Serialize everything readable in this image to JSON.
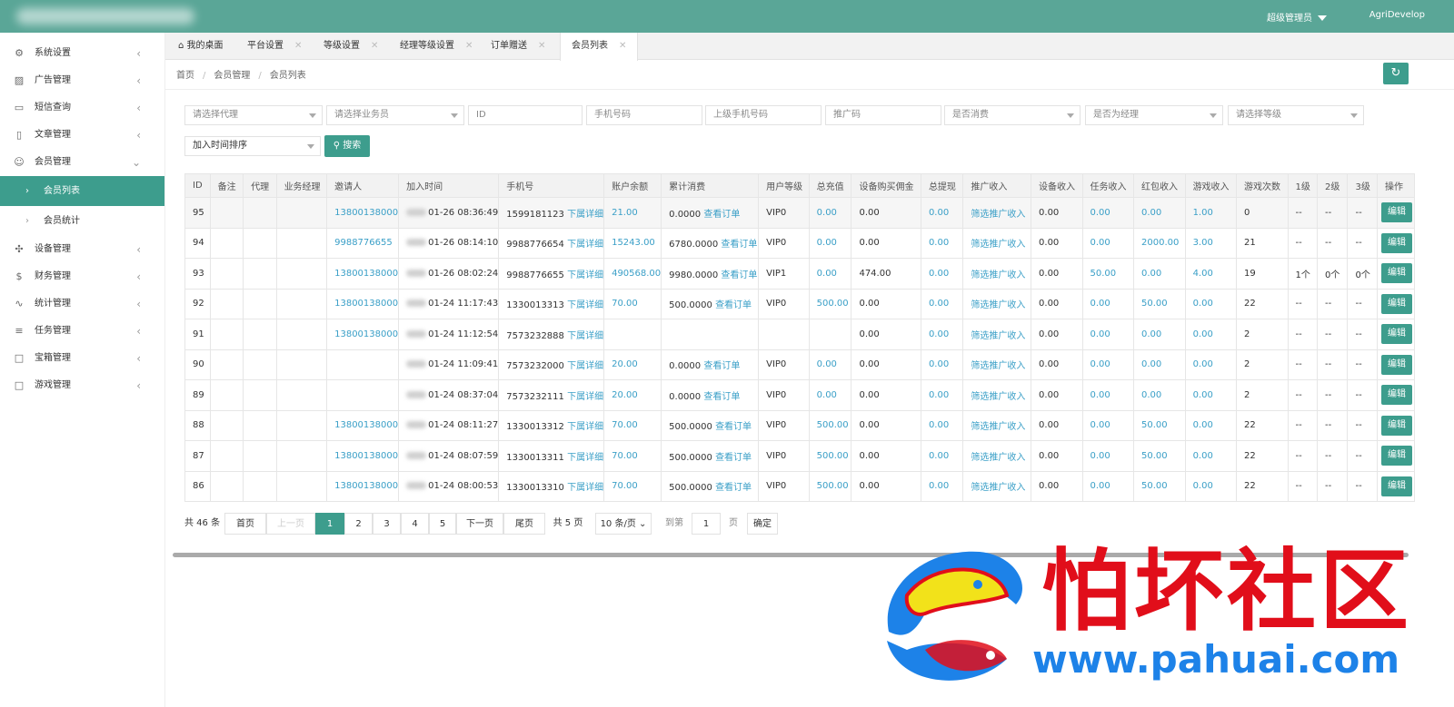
{
  "header": {
    "user": "超级管理员",
    "project": "AgriDevelop"
  },
  "sidebar": {
    "items": [
      {
        "label": "系统设置",
        "icon": "gear-icon"
      },
      {
        "label": "广告管理",
        "icon": "image-icon"
      },
      {
        "label": "短信查询",
        "icon": "message-icon"
      },
      {
        "label": "文章管理",
        "icon": "book-icon"
      },
      {
        "label": "会员管理",
        "icon": "user-icon"
      },
      {
        "label": "设备管理",
        "icon": "device-icon"
      },
      {
        "label": "财务管理",
        "icon": "dollar-icon"
      },
      {
        "label": "统计管理",
        "icon": "pulse-icon"
      },
      {
        "label": "任务管理",
        "icon": "sliders-icon"
      },
      {
        "label": "宝箱管理",
        "icon": "gift-icon"
      },
      {
        "label": "游戏管理",
        "icon": "gamepad-icon"
      }
    ],
    "sub": [
      {
        "label": "会员列表"
      },
      {
        "label": "会员统计"
      }
    ]
  },
  "tabs": [
    {
      "label": "我的桌面"
    },
    {
      "label": "平台设置"
    },
    {
      "label": "等级设置"
    },
    {
      "label": "经理等级设置"
    },
    {
      "label": "订单赠送"
    },
    {
      "label": "会员列表"
    }
  ],
  "breadcrumb": [
    "首页",
    "会员管理",
    "会员列表"
  ],
  "filters": {
    "agent": "请选择代理",
    "salesman": "请选择业务员",
    "id": "ID",
    "phone": "手机号码",
    "parent_phone": "上级手机号码",
    "promo": "推广码",
    "consumed": "是否消费",
    "manager": "是否为经理",
    "level": "请选择等级",
    "sort": "加入时间排序",
    "search": "搜索"
  },
  "table": {
    "headers": [
      "ID",
      "备注",
      "代理",
      "业务经理",
      "邀请人",
      "加入时间",
      "手机号",
      "账户余额",
      "累计消费",
      "用户等级",
      "总充值",
      "设备购买佣金",
      "总提现",
      "推广收入",
      "设备收入",
      "任务收入",
      "红包收入",
      "游戏收入",
      "游戏次数",
      "1级",
      "2级",
      "3级",
      "操作"
    ],
    "detail_link": "下属详细",
    "order_link": "查看订单",
    "promo_link": "筛选推广收入",
    "edit_label": "编辑",
    "rows": [
      {
        "id": "95",
        "inviter": "13800138000",
        "time": "01-26 08:36:49",
        "phone": "1599181123",
        "balance": "21.00",
        "spent": "0.0000",
        "level": "VIP0",
        "recharge": "0.00",
        "commission": "0.00",
        "withdraw": "0.00",
        "device": "0.00",
        "task": "0.00",
        "redpack": "0.00",
        "game": "1.00",
        "count": "0",
        "l1": "--",
        "l2": "--",
        "l3": "--"
      },
      {
        "id": "94",
        "inviter": "9988776655",
        "time": "01-26 08:14:10",
        "phone": "9988776654",
        "balance": "15243.00",
        "spent": "6780.0000",
        "level": "VIP0",
        "recharge": "0.00",
        "commission": "0.00",
        "withdraw": "0.00",
        "device": "0.00",
        "task": "0.00",
        "redpack": "2000.00",
        "game": "3.00",
        "count": "21",
        "l1": "--",
        "l2": "--",
        "l3": "--"
      },
      {
        "id": "93",
        "inviter": "13800138000",
        "time": "01-26 08:02:24",
        "phone": "9988776655",
        "balance": "490568.00",
        "spent": "9980.0000",
        "level": "VIP1",
        "recharge": "0.00",
        "commission": "474.00",
        "withdraw": "0.00",
        "device": "0.00",
        "task": "50.00",
        "redpack": "0.00",
        "game": "4.00",
        "count": "19",
        "l1": "1个",
        "l2": "0个",
        "l3": "0个"
      },
      {
        "id": "92",
        "inviter": "13800138000",
        "time": "01-24 11:17:43",
        "phone": "1330013313",
        "balance": "70.00",
        "spent": "500.0000",
        "level": "VIP0",
        "recharge": "500.00",
        "commission": "0.00",
        "withdraw": "0.00",
        "device": "0.00",
        "task": "0.00",
        "redpack": "50.00",
        "game": "0.00",
        "count": "22",
        "l1": "--",
        "l2": "--",
        "l3": "--"
      },
      {
        "id": "91",
        "inviter": "13800138000",
        "time": "01-24 11:12:54",
        "phone": "7573232888",
        "balance": "",
        "spent": "",
        "level": "",
        "recharge": "",
        "commission": "0.00",
        "withdraw": "0.00",
        "device": "0.00",
        "task": "0.00",
        "redpack": "0.00",
        "game": "0.00",
        "count": "2",
        "l1": "--",
        "l2": "--",
        "l3": "--"
      },
      {
        "id": "90",
        "inviter": "",
        "time": "01-24 11:09:41",
        "phone": "7573232000",
        "balance": "20.00",
        "spent": "0.0000",
        "level": "VIP0",
        "recharge": "0.00",
        "commission": "0.00",
        "withdraw": "0.00",
        "device": "0.00",
        "task": "0.00",
        "redpack": "0.00",
        "game": "0.00",
        "count": "2",
        "l1": "--",
        "l2": "--",
        "l3": "--"
      },
      {
        "id": "89",
        "inviter": "",
        "time": "01-24 08:37:04",
        "phone": "7573232111",
        "balance": "20.00",
        "spent": "0.0000",
        "level": "VIP0",
        "recharge": "0.00",
        "commission": "0.00",
        "withdraw": "0.00",
        "device": "0.00",
        "task": "0.00",
        "redpack": "0.00",
        "game": "0.00",
        "count": "2",
        "l1": "--",
        "l2": "--",
        "l3": "--"
      },
      {
        "id": "88",
        "inviter": "13800138000",
        "time": "01-24 08:11:27",
        "phone": "1330013312",
        "balance": "70.00",
        "spent": "500.0000",
        "level": "VIP0",
        "recharge": "500.00",
        "commission": "0.00",
        "withdraw": "0.00",
        "device": "0.00",
        "task": "0.00",
        "redpack": "50.00",
        "game": "0.00",
        "count": "22",
        "l1": "--",
        "l2": "--",
        "l3": "--"
      },
      {
        "id": "87",
        "inviter": "13800138000",
        "time": "01-24 08:07:59",
        "phone": "1330013311",
        "balance": "70.00",
        "spent": "500.0000",
        "level": "VIP0",
        "recharge": "500.00",
        "commission": "0.00",
        "withdraw": "0.00",
        "device": "0.00",
        "task": "0.00",
        "redpack": "50.00",
        "game": "0.00",
        "count": "22",
        "l1": "--",
        "l2": "--",
        "l3": "--"
      },
      {
        "id": "86",
        "inviter": "13800138000",
        "time": "01-24 08:00:53",
        "phone": "1330013310",
        "balance": "70.00",
        "spent": "500.0000",
        "level": "VIP0",
        "recharge": "500.00",
        "commission": "0.00",
        "withdraw": "0.00",
        "device": "0.00",
        "task": "0.00",
        "redpack": "50.00",
        "game": "0.00",
        "count": "22",
        "l1": "--",
        "l2": "--",
        "l3": "--"
      }
    ]
  },
  "pagination": {
    "total": "共 46 条",
    "first": "首页",
    "prev": "上一页",
    "pages": [
      "1",
      "2",
      "3",
      "4",
      "5"
    ],
    "next": "下一页",
    "last": "尾页",
    "total_pages": "共 5 页",
    "per_page": "10 条/页",
    "goto": "到第",
    "goto_value": "1",
    "page_unit": "页",
    "confirm": "确定"
  },
  "watermark": {
    "text": "怕坏社区",
    "url": "www.pahuai.com"
  },
  "colors": {
    "header": "#5aa697",
    "accent": "#3d9d8d",
    "link": "#3a9fc7",
    "watermark_red": "#e10e1a",
    "watermark_blue": "#1d82e8"
  }
}
